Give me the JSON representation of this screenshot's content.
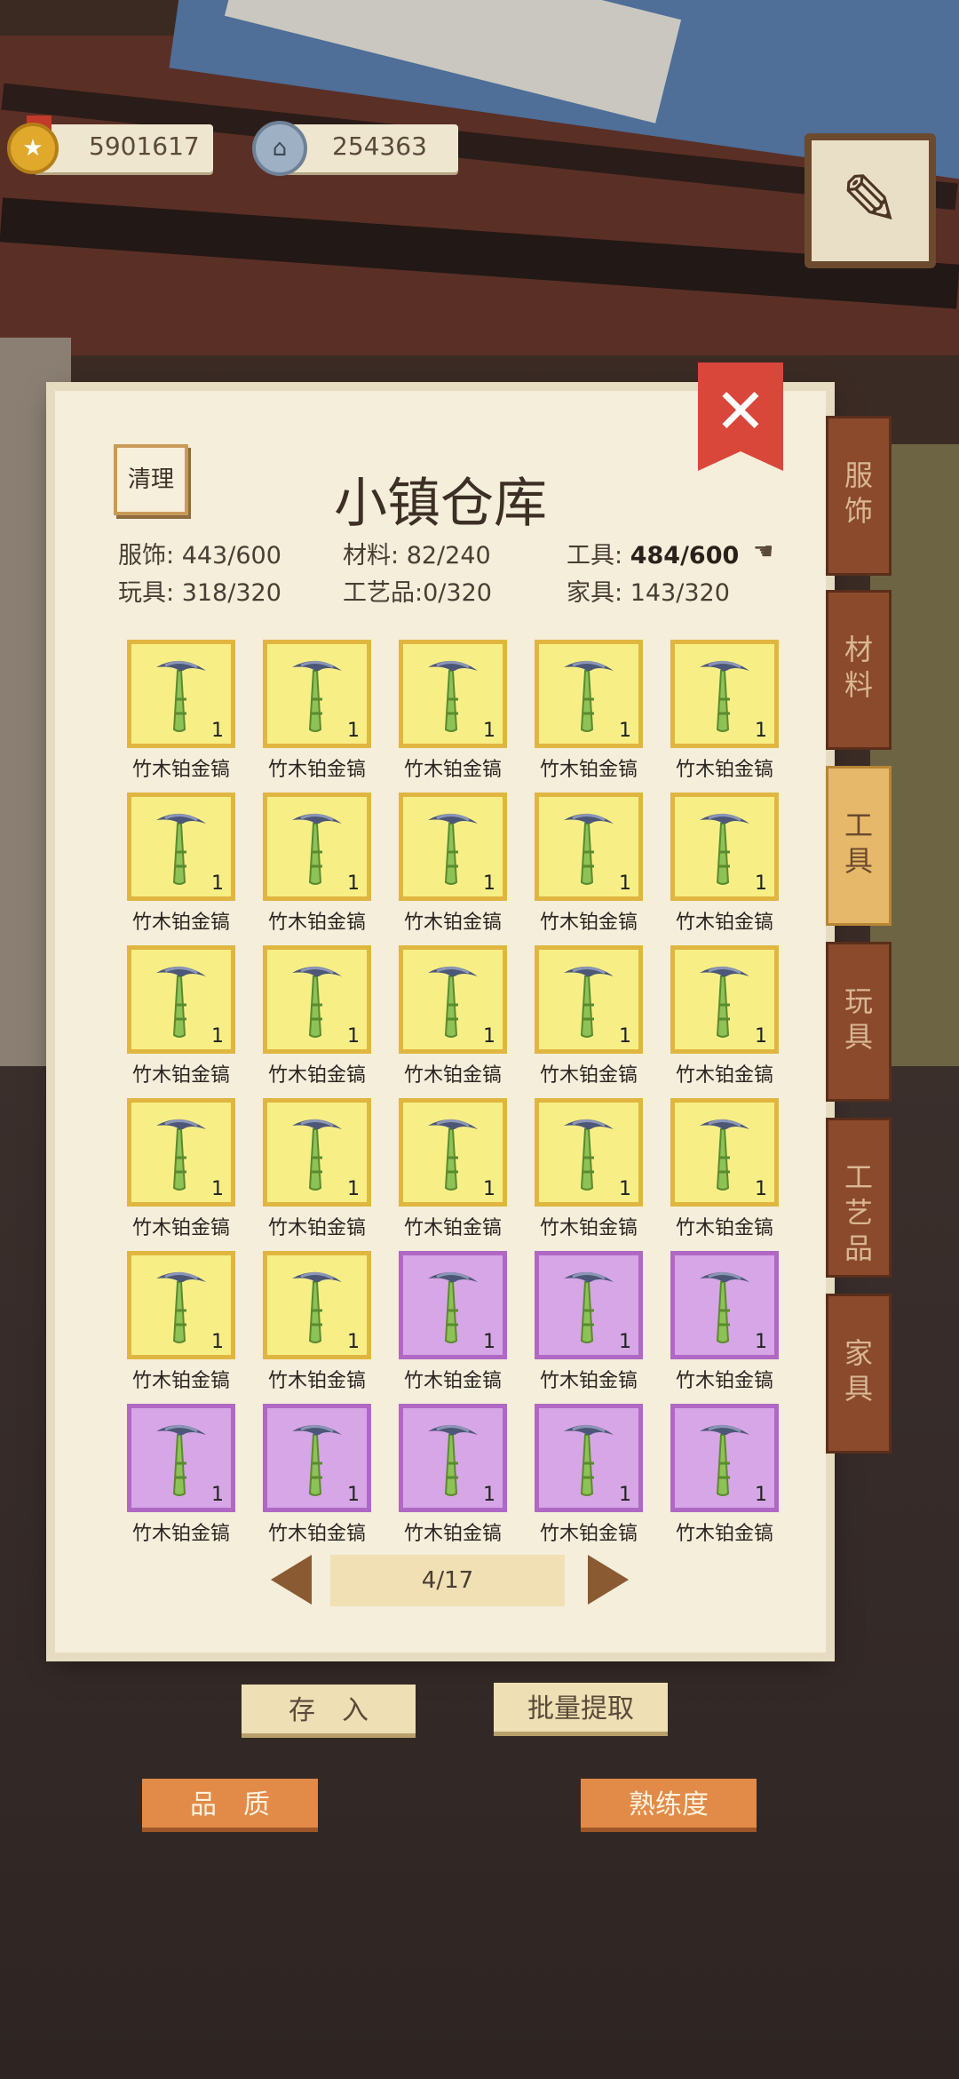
{
  "currency": {
    "gold": "5901617",
    "silver": "254363"
  },
  "icons": {
    "gold_coin": "gold-coin-icon",
    "silver_coin": "silver-coin-icon",
    "journal": "journal-icon",
    "close": "close-icon",
    "hand": "pointing-hand-icon",
    "item": "pickaxe-icon"
  },
  "panel": {
    "title": "小镇仓库",
    "clean_label": "清理",
    "close_label": "✕"
  },
  "stats": [
    {
      "label": "服饰:",
      "value": "443/600"
    },
    {
      "label": "材料:",
      "value": "82/240"
    },
    {
      "label": "工具:",
      "value": "484/600"
    },
    {
      "label": "玩具:",
      "value": "318/320"
    },
    {
      "label": "工艺品:",
      "value": "0/320"
    },
    {
      "label": "家具:",
      "value": "143/320"
    }
  ],
  "items": [
    {
      "name": "竹木铂金镐",
      "count": "1",
      "quality": "yellow"
    },
    {
      "name": "竹木铂金镐",
      "count": "1",
      "quality": "yellow"
    },
    {
      "name": "竹木铂金镐",
      "count": "1",
      "quality": "yellow"
    },
    {
      "name": "竹木铂金镐",
      "count": "1",
      "quality": "yellow"
    },
    {
      "name": "竹木铂金镐",
      "count": "1",
      "quality": "yellow"
    },
    {
      "name": "竹木铂金镐",
      "count": "1",
      "quality": "yellow"
    },
    {
      "name": "竹木铂金镐",
      "count": "1",
      "quality": "yellow"
    },
    {
      "name": "竹木铂金镐",
      "count": "1",
      "quality": "yellow"
    },
    {
      "name": "竹木铂金镐",
      "count": "1",
      "quality": "yellow"
    },
    {
      "name": "竹木铂金镐",
      "count": "1",
      "quality": "yellow"
    },
    {
      "name": "竹木铂金镐",
      "count": "1",
      "quality": "yellow"
    },
    {
      "name": "竹木铂金镐",
      "count": "1",
      "quality": "yellow"
    },
    {
      "name": "竹木铂金镐",
      "count": "1",
      "quality": "yellow"
    },
    {
      "name": "竹木铂金镐",
      "count": "1",
      "quality": "yellow"
    },
    {
      "name": "竹木铂金镐",
      "count": "1",
      "quality": "yellow"
    },
    {
      "name": "竹木铂金镐",
      "count": "1",
      "quality": "yellow"
    },
    {
      "name": "竹木铂金镐",
      "count": "1",
      "quality": "yellow"
    },
    {
      "name": "竹木铂金镐",
      "count": "1",
      "quality": "yellow"
    },
    {
      "name": "竹木铂金镐",
      "count": "1",
      "quality": "yellow"
    },
    {
      "name": "竹木铂金镐",
      "count": "1",
      "quality": "yellow"
    },
    {
      "name": "竹木铂金镐",
      "count": "1",
      "quality": "yellow"
    },
    {
      "name": "竹木铂金镐",
      "count": "1",
      "quality": "yellow"
    },
    {
      "name": "竹木铂金镐",
      "count": "1",
      "quality": "purple"
    },
    {
      "name": "竹木铂金镐",
      "count": "1",
      "quality": "purple"
    },
    {
      "name": "竹木铂金镐",
      "count": "1",
      "quality": "purple"
    },
    {
      "name": "竹木铂金镐",
      "count": "1",
      "quality": "purple"
    },
    {
      "name": "竹木铂金镐",
      "count": "1",
      "quality": "purple"
    },
    {
      "name": "竹木铂金镐",
      "count": "1",
      "quality": "purple"
    },
    {
      "name": "竹木铂金镐",
      "count": "1",
      "quality": "purple"
    },
    {
      "name": "竹木铂金镐",
      "count": "1",
      "quality": "purple"
    }
  ],
  "pagination": {
    "text": "4/17"
  },
  "tabs": [
    {
      "label": "服饰",
      "active": false
    },
    {
      "label": "材料",
      "active": false
    },
    {
      "label": "工具",
      "active": true
    },
    {
      "label": "玩具",
      "active": false
    },
    {
      "label": "工艺品",
      "active": false
    },
    {
      "label": "家具",
      "active": false
    }
  ],
  "buttons": {
    "deposit": "存　入",
    "batch_withdraw": "批量提取",
    "quality": "品　质",
    "proficiency": "熟练度"
  },
  "colors": {
    "yellow_frame": "#e0b640",
    "yellow_fill": "#f7ef86",
    "purple_frame": "#b068c4",
    "purple_fill": "#d7a6e6",
    "close_red": "#d9473a",
    "tab_brown": "#8b4a2c",
    "tab_active": "#e6b86a"
  }
}
